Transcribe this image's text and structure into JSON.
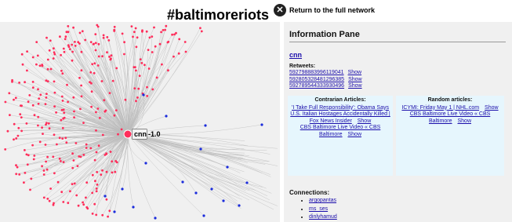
{
  "header": {
    "title": "#baltimoreriots",
    "return_button_icon": "close-circle-icon",
    "return_label": "Return to the full network"
  },
  "graph": {
    "focus_node_label": "cnn",
    "focus_node_score": "-1.0",
    "colors": {
      "retweeter_node": "#ff2d5a",
      "other_node": "#1a2bdc",
      "edge": "#bdbdbd",
      "background": "#f0f0f0"
    }
  },
  "info_pane": {
    "title": "Information Pane",
    "user": "cnn",
    "retweets_label": "Retweets:",
    "show_label": "Show",
    "retweets": [
      "592798883996119041",
      "592805328481296385",
      "592789544333930496"
    ],
    "contrarian": {
      "heading": "Contrarian Articles:",
      "articles": [
        "'I Take Full Responsibility': Obama Says U.S. Italian Hostages Accidentally Killed | Fox News Insider",
        "CBS Baltimore Live Video « CBS Baltimore"
      ]
    },
    "random": {
      "heading": "Random articles:",
      "articles": [
        "ICYMI: Friday May 1 | NHL.com",
        "CBS Baltimore Live Video « CBS Baltimore"
      ]
    },
    "connections_label": "Connections:",
    "connections": [
      "argopantas",
      "ms_ses",
      "dinlyhamud"
    ]
  }
}
